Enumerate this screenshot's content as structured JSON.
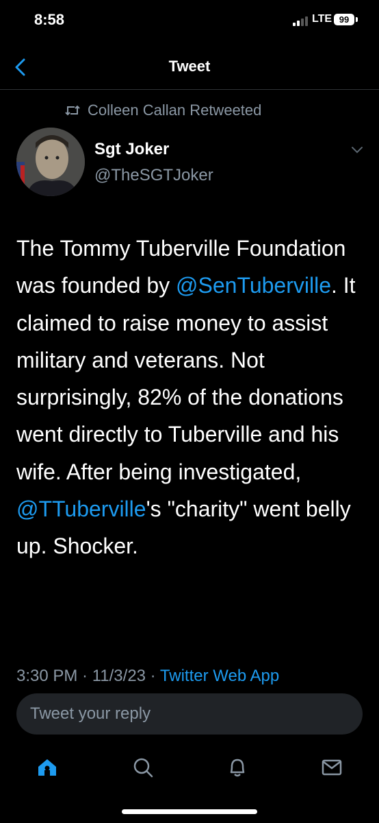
{
  "status_bar": {
    "time": "8:58",
    "network": "LTE",
    "battery": "99"
  },
  "nav": {
    "title": "Tweet",
    "back_icon": "chevron-left-icon"
  },
  "retweet": {
    "icon": "retweet-icon",
    "label": "Colleen Callan Retweeted"
  },
  "author": {
    "name": "Sgt Joker",
    "handle": "@TheSGTJoker"
  },
  "tweet": {
    "text_1": "The Tommy Tuberville Foundation was founded by ",
    "mention_1": "@SenTuberville",
    "text_2": ". It claimed to raise money to assist military and veterans. Not surprisingly, 82% of the donations went directly to Tuberville and his wife. After being investigated, ",
    "mention_2": "@TTuberville",
    "text_3": "'s \"charity\" went belly up. Shocker."
  },
  "meta": {
    "time": "3:30 PM",
    "sep1": " · ",
    "date": "11/3/23",
    "sep2": " · ",
    "app": "Twitter Web App"
  },
  "reply": {
    "placeholder": "Tweet your reply"
  },
  "tabs": [
    {
      "name": "home-icon",
      "active": true
    },
    {
      "name": "search-icon",
      "active": false
    },
    {
      "name": "bell-icon",
      "active": false
    },
    {
      "name": "mail-icon",
      "active": false
    }
  ],
  "colors": {
    "accent": "#1d9bf0",
    "muted": "#8b98a5",
    "background": "#000000",
    "reply_bg": "#202327"
  }
}
